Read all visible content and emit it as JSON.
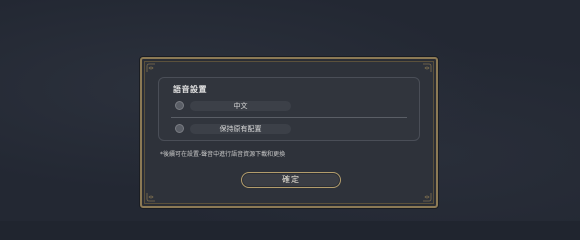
{
  "dialog": {
    "section_title": "語音設置",
    "options": [
      {
        "label": "中文",
        "selected": false
      },
      {
        "label": "保持原有配置",
        "selected": false
      }
    ],
    "note": "*後續可在設置-聲音中進行語音資源下載和更換",
    "confirm_label": "確定"
  },
  "colors": {
    "background": "#232833",
    "panel": "#2e323a",
    "gold_border": "#8c7a55",
    "button_border": "#b39d6c"
  },
  "icons": {
    "corners": "ornament-corner-icon",
    "radio": "radio-circle-icon"
  }
}
